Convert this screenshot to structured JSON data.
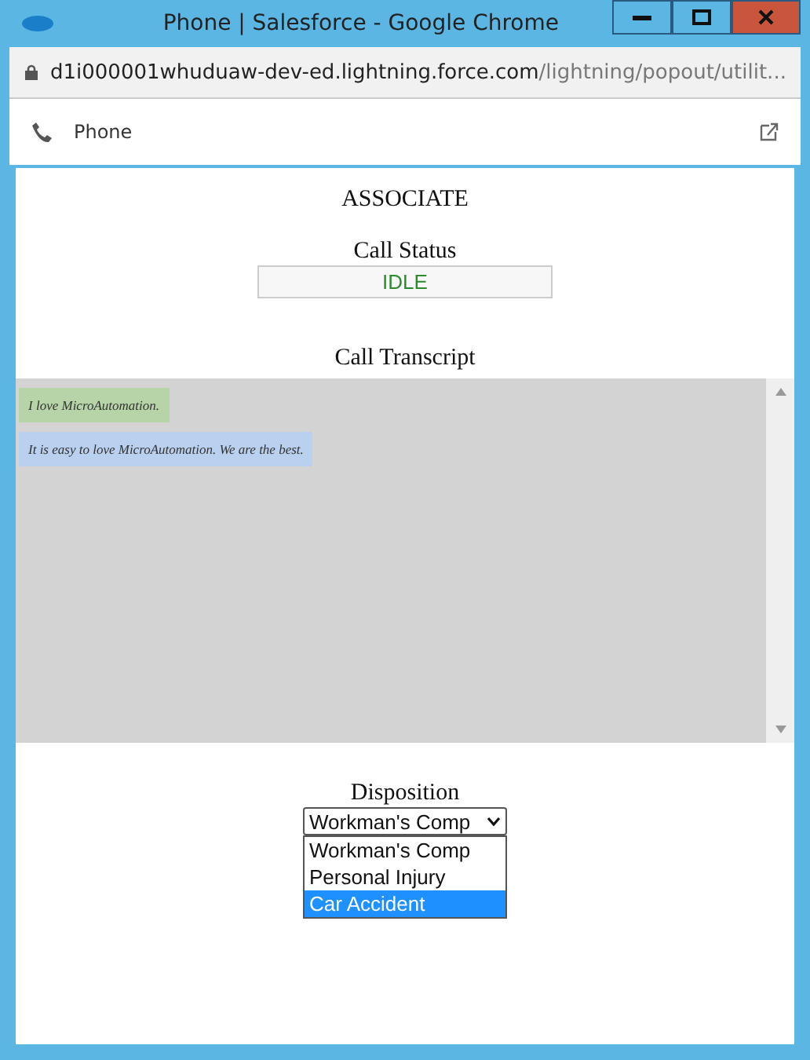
{
  "window": {
    "title": "Phone | Salesforce - Google Chrome",
    "url_host": "d1i000001whuduaw-dev-ed.lightning.force.com",
    "url_path": "/lightning/popout/utilit..."
  },
  "panel": {
    "title": "Phone"
  },
  "heading": "ASSOCIATE",
  "call_status": {
    "label": "Call Status",
    "value": "IDLE"
  },
  "transcript": {
    "label": "Call Transcript",
    "messages": [
      {
        "text": "I love MicroAutomation.",
        "color": "#b6d4a8"
      },
      {
        "text": "It is easy to love MicroAutomation. We are the best.",
        "color": "#b9d0ee"
      }
    ]
  },
  "disposition": {
    "label": "Disposition",
    "value": "Workman's Comp",
    "options": [
      {
        "label": "Workman's Comp",
        "highlighted": false
      },
      {
        "label": "Personal Injury",
        "highlighted": false
      },
      {
        "label": "Car Accident",
        "highlighted": true
      }
    ]
  }
}
